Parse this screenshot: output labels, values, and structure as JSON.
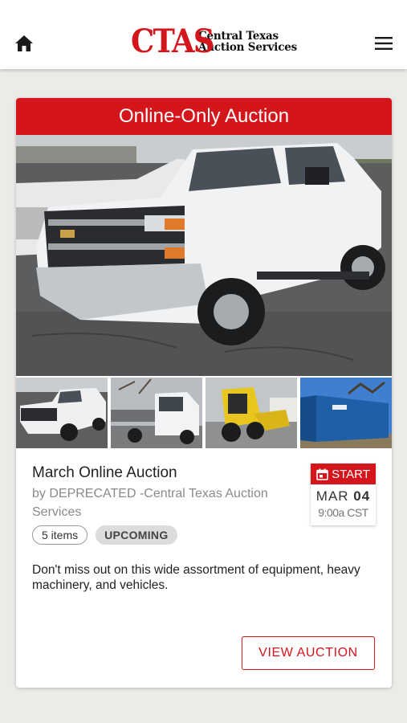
{
  "header": {
    "logo_mark": "CTAS",
    "logo_line1": "Central Texas",
    "logo_line2": "Auction Services",
    "home_icon": "home-icon",
    "menu_icon": "hamburger-menu-icon"
  },
  "auction": {
    "banner": "Online-Only Auction",
    "title": "March Online Auction",
    "byline": "by DEPRECATED -Central Texas Auction Services",
    "items_chip": "5 items",
    "status_chip": "UPCOMING",
    "date": {
      "label": "START",
      "month": "MAR",
      "day": "04",
      "time": "9:00a CST"
    },
    "description": "Don't miss out on this wide assortment of equipment, heavy machinery, and vehicles.",
    "cta": "VIEW AUCTION",
    "carousel": {
      "total": 5,
      "active": 1
    },
    "thumbnails": [
      "white-pickup-truck",
      "white-semi-truck",
      "yellow-skid-steer",
      "blue-shipping-container"
    ]
  },
  "colors": {
    "brand_red": "#d4151b",
    "background": "#ecebe8"
  }
}
